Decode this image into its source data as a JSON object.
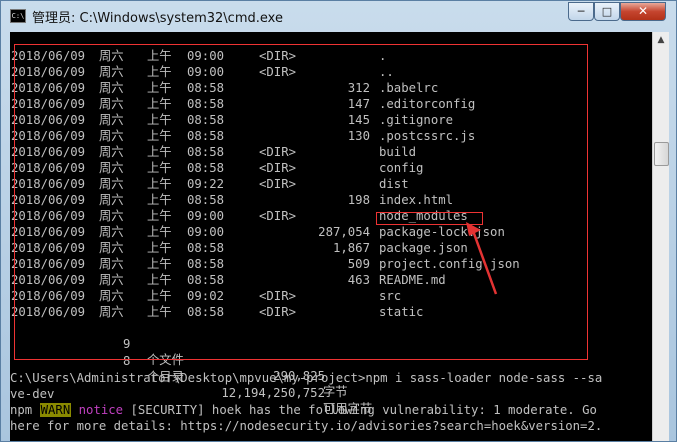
{
  "window": {
    "title": "管理员: C:\\Windows\\system32\\cmd.exe",
    "minimize_label": "─",
    "maximize_label": "□",
    "close_label": "✕"
  },
  "listing": [
    {
      "date": "2018/06/09",
      "day": "周六",
      "ampm": "上午",
      "time": "09:00",
      "dir": "<DIR>",
      "size": "",
      "name": "."
    },
    {
      "date": "2018/06/09",
      "day": "周六",
      "ampm": "上午",
      "time": "09:00",
      "dir": "<DIR>",
      "size": "",
      "name": ".."
    },
    {
      "date": "2018/06/09",
      "day": "周六",
      "ampm": "上午",
      "time": "08:58",
      "dir": "",
      "size": "312",
      "name": ".babelrc"
    },
    {
      "date": "2018/06/09",
      "day": "周六",
      "ampm": "上午",
      "time": "08:58",
      "dir": "",
      "size": "147",
      "name": ".editorconfig"
    },
    {
      "date": "2018/06/09",
      "day": "周六",
      "ampm": "上午",
      "time": "08:58",
      "dir": "",
      "size": "145",
      "name": ".gitignore"
    },
    {
      "date": "2018/06/09",
      "day": "周六",
      "ampm": "上午",
      "time": "08:58",
      "dir": "",
      "size": "130",
      "name": ".postcssrc.js"
    },
    {
      "date": "2018/06/09",
      "day": "周六",
      "ampm": "上午",
      "time": "08:58",
      "dir": "<DIR>",
      "size": "",
      "name": "build"
    },
    {
      "date": "2018/06/09",
      "day": "周六",
      "ampm": "上午",
      "time": "08:58",
      "dir": "<DIR>",
      "size": "",
      "name": "config"
    },
    {
      "date": "2018/06/09",
      "day": "周六",
      "ampm": "上午",
      "time": "09:22",
      "dir": "<DIR>",
      "size": "",
      "name": "dist"
    },
    {
      "date": "2018/06/09",
      "day": "周六",
      "ampm": "上午",
      "time": "08:58",
      "dir": "",
      "size": "198",
      "name": "index.html"
    },
    {
      "date": "2018/06/09",
      "day": "周六",
      "ampm": "上午",
      "time": "09:00",
      "dir": "<DIR>",
      "size": "",
      "name": "node_modules"
    },
    {
      "date": "2018/06/09",
      "day": "周六",
      "ampm": "上午",
      "time": "09:00",
      "dir": "",
      "size": "287,054",
      "name": "package-lock.json"
    },
    {
      "date": "2018/06/09",
      "day": "周六",
      "ampm": "上午",
      "time": "08:58",
      "dir": "",
      "size": "1,867",
      "name": "package.json"
    },
    {
      "date": "2018/06/09",
      "day": "周六",
      "ampm": "上午",
      "time": "08:58",
      "dir": "",
      "size": "509",
      "name": "project.config.json"
    },
    {
      "date": "2018/06/09",
      "day": "周六",
      "ampm": "上午",
      "time": "08:58",
      "dir": "",
      "size": "463",
      "name": "README.md"
    },
    {
      "date": "2018/06/09",
      "day": "周六",
      "ampm": "上午",
      "time": "09:02",
      "dir": "<DIR>",
      "size": "",
      "name": "src"
    },
    {
      "date": "2018/06/09",
      "day": "周六",
      "ampm": "上午",
      "time": "08:58",
      "dir": "<DIR>",
      "size": "",
      "name": "static"
    }
  ],
  "summary": {
    "files": {
      "count": "9",
      "word": "个文件",
      "bytes": "290,825",
      "unit": "字节"
    },
    "dirs": {
      "count": "8",
      "word": "个目录",
      "bytes": "12,194,250,752",
      "unit": "可用字节"
    }
  },
  "command": {
    "line1": "C:\\Users\\Administrator\\Desktop\\mpvue\\my-project>npm i sass-loader node-sass --sa",
    "line2": "ve-dev"
  },
  "npm_output": {
    "prefix": "npm",
    "warn": "WARN",
    "notice": "notice",
    "message": "[SECURITY] hoek has the following vulnerability: 1 moderate. Go",
    "line2": "here for more details: https://nodesecurity.io/advisories?search=hoek&version=2."
  },
  "colors": {
    "annotation": "#e33333",
    "console_bg": "#000000",
    "console_text": "#c0c0c0"
  },
  "icons": {
    "title_icon": "cmd-icon"
  }
}
